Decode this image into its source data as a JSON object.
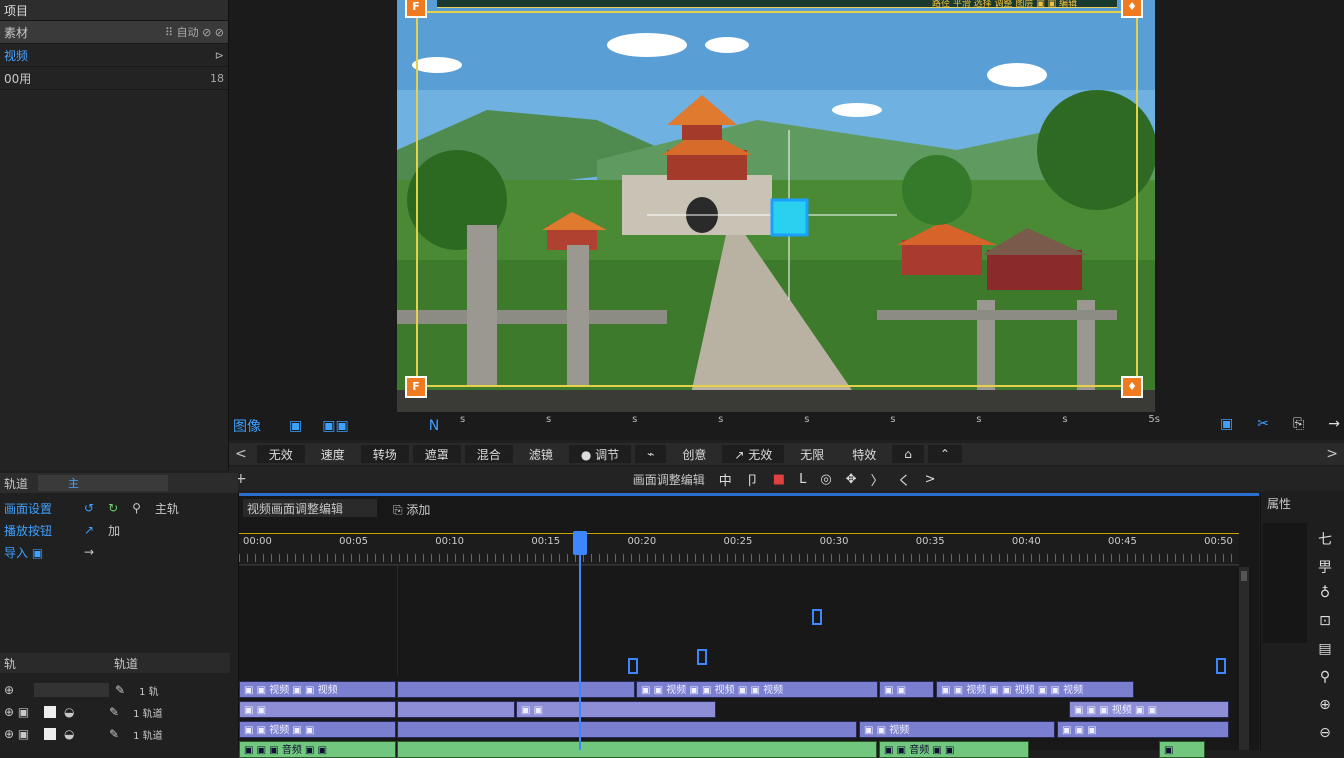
{
  "project_panel": {
    "header": "项目",
    "rows": [
      {
        "label": "素材",
        "right": "⠿ 自动 ⊘ ⊘"
      },
      {
        "label": "视频",
        "right": "⊳"
      },
      {
        "label": "00用",
        "right": "18"
      }
    ]
  },
  "viewer": {
    "overlay_caption": "路径 平滑 选择 调整 图层 ▣ ▣ 编辑",
    "corner_top_left": "F",
    "corner_bottom_left": "F",
    "left_tools": [
      "图像",
      "▣",
      "▣▣",
      "N"
    ],
    "timecodes": [
      "s",
      "s",
      "s",
      "s",
      "s",
      "s",
      "s",
      "s",
      "5s"
    ],
    "right_tools": [
      "▣",
      "✂",
      "⎘",
      "→"
    ]
  },
  "effects_bar": {
    "items": [
      "无效",
      "速度",
      "转场",
      "遮罩",
      "混合",
      "滤镜",
      "● 调节",
      "⌁",
      "创意",
      "↗ 无效",
      "无限",
      "特效",
      "⌂",
      "⌃"
    ],
    "left_arrow": "<",
    "right_arrow": ">"
  },
  "toolbar": {
    "left": "+",
    "label": "画面调整编辑",
    "buttons": [
      "中",
      "卩",
      "■",
      "L",
      "◎",
      "✥",
      "〉",
      "く",
      ">"
    ]
  },
  "timeline_left": {
    "header_label": "轨道",
    "header_value": "主",
    "tools": [
      {
        "label": "画面设置",
        "icons": [
          "↺",
          "↻",
          "⚲",
          "主轨"
        ]
      },
      {
        "label": "播放按钮",
        "icons": [
          "↗",
          "加"
        ]
      },
      {
        "label": "导入 ▣",
        "icons": [
          "→"
        ]
      }
    ],
    "track_header": {
      "left": "轨",
      "right": "轨道"
    },
    "tracks": [
      {
        "label": "⊕",
        "icon": "✎",
        "value": "1 轨"
      },
      {
        "label": "⊕ ▣",
        "icon": "✎",
        "value": "1 轨道"
      },
      {
        "label": "⊕ ▣",
        "icon": "✎",
        "value": "1 轨道"
      }
    ]
  },
  "timeline": {
    "header": "视频画面调整编辑",
    "header_btn": "⎘ 添加",
    "ruler_labels": [
      "00:00",
      "00:05",
      "00:10",
      "00:15",
      "00:20",
      "00:25",
      "00:30",
      "00:35",
      "00:40",
      "00:45",
      "00:50"
    ],
    "clips_row1": [
      "▣ ▣ 视频 ▣ ▣ 视频",
      "",
      "▣ ▣ 视频 ▣ ▣ 视频 ▣ ▣ 视频",
      "▣ ▣",
      "▣ ▣ 视频 ▣ ▣ 视频 ▣ ▣ 视频"
    ],
    "clips_row2": [
      "▣ ▣",
      "",
      "▣ ▣",
      "",
      "▣ ▣ ▣ 视频 ▣ ▣"
    ],
    "clips_row3": [
      "▣ ▣ 视频 ▣ ▣",
      "",
      "▣ ▣ 视频",
      "▣ ▣ ▣"
    ],
    "clips_row4": [
      "▣ ▣ ▣ 音频 ▣ ▣",
      "",
      "▣ ▣ 音频 ▣ ▣",
      "▣"
    ]
  },
  "right_panel": {
    "header": "属性",
    "icons": [
      "七",
      "甼",
      "♁",
      "⊡",
      "▤",
      "⚲",
      "⊕",
      "⊖"
    ]
  },
  "colors": {
    "accent": "#3e86ff",
    "video_clip": "#7b7fcf",
    "audio_clip": "#71c77e",
    "ruler_marker": "#c8a200"
  }
}
